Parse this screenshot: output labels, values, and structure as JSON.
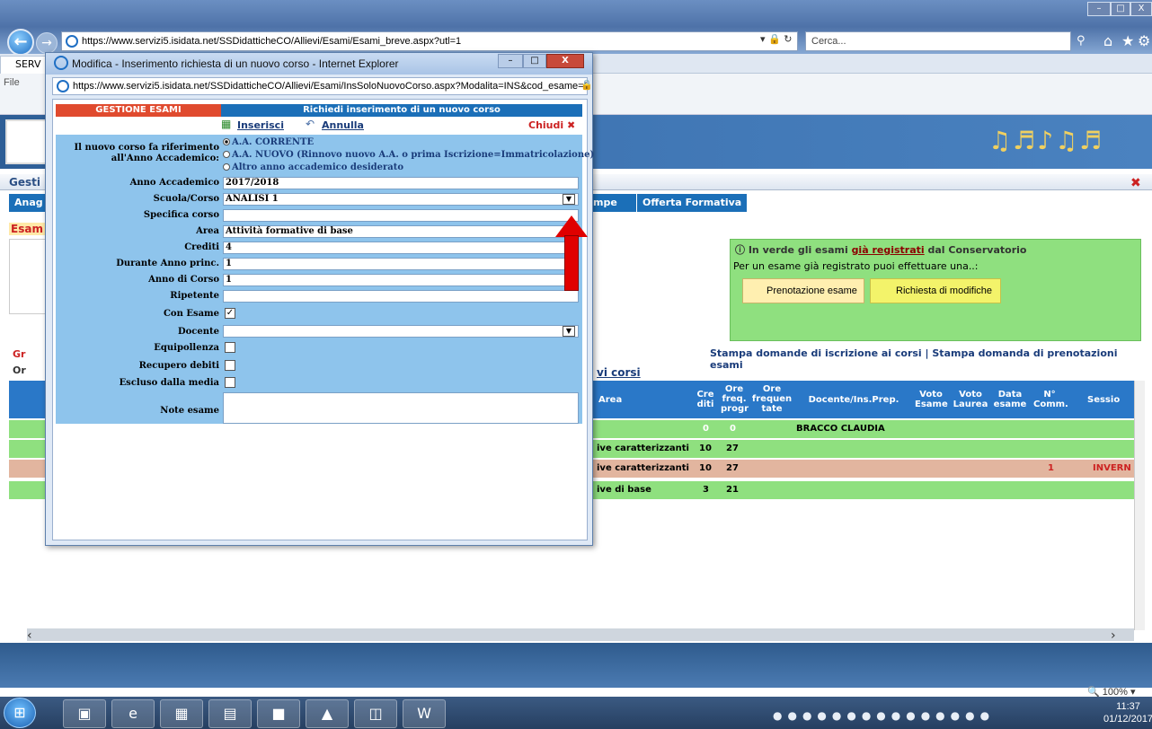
{
  "browser": {
    "url": "https://www.servizi5.isidata.net/SSDidatticheCO/Allievi/Esami/Esami_breve.aspx?utl=1",
    "search_placeholder": "Cerca...",
    "tab_label": "SERV",
    "menu_visible": "File",
    "zoom": "100%"
  },
  "page": {
    "gest_label": "Gesti",
    "nav_anag": "Anag",
    "nav_stampe": "mpe",
    "nav_offerta": "Offerta Formativa",
    "esami_label": "Esam",
    "green_title_pre": "In verde gli esami ",
    "green_title_link": "già registrati",
    "green_title_post": " dal Conservatorio",
    "green_sub": "Per un esame già registrato puoi effettuare una..:",
    "btn_prenotazione": "Prenotazione esame",
    "btn_richiesta": "Richiesta di modifiche",
    "stampa_links": "Stampa domande di iscrizione ai corsi | Stampa domanda di prenotazioni esami",
    "vi_corsi": "vi corsi",
    "gr_label": "Gr",
    "or_label": "Or",
    "table_headers": {
      "area": "Area",
      "crediti": "Cre diti",
      "ore_freq_progr": "Ore freq. progr",
      "ore_frequentate": "Ore frequen tate",
      "docente": "Docente/Ins.Prep.",
      "voto_esame": "Voto Esame",
      "voto_laurea": "Voto Laurea",
      "data_esame": "Data esame",
      "n_comm": "N° Comm.",
      "sessione": "Sessio"
    },
    "rows": [
      {
        "area": "",
        "crediti": "0",
        "ore": "0",
        "docente": "BRACCO CLAUDIA",
        "n_comm": "",
        "sessione": ""
      },
      {
        "area": "ive caratterizzanti",
        "crediti": "10",
        "ore": "27",
        "docente": "",
        "n_comm": "",
        "sessione": ""
      },
      {
        "area": "ive caratterizzanti",
        "crediti": "10",
        "ore": "27",
        "docente": "",
        "n_comm": "1",
        "sessione": "INVERN"
      },
      {
        "area": "ive di base",
        "crediti": "3",
        "ore": "21",
        "docente": "",
        "n_comm": "",
        "sessione": ""
      }
    ]
  },
  "popup": {
    "window_title": "Modifica - Inserimento richiesta di un nuovo corso - Internet Explorer",
    "url": "https://www.servizi5.isidata.net/SSDidatticheCO/Allievi/Esami/InsSoloNuovoCorso.aspx?Modalita=INS&cod_esame=0",
    "section_left": "GESTIONE ESAMI",
    "section_title": "Richiedi inserimento di un nuovo corso",
    "inserisci": "Inserisci",
    "annulla": "Annulla",
    "chiudi": "Chiudi",
    "form": {
      "rif_label": "Il nuovo corso fa riferimento all'Anno Accademico:",
      "radio_1": "A.A. CORRENTE",
      "radio_2": "A.A. NUOVO (Rinnovo nuovo A.A. o prima Iscrizione=Immatricolazione)",
      "radio_3": "Altro anno accademico desiderato",
      "anno_label": "Anno Accademico",
      "anno_value": "2017/2018",
      "scuola_label": "Scuola/Corso",
      "scuola_value": "ANALISI 1",
      "specifica_label": "Specifica corso",
      "specifica_value": "",
      "area_label": "Area",
      "area_value": "Attività formative di base",
      "crediti_label": "Crediti",
      "crediti_value": "4",
      "durante_label": "Durante Anno princ.",
      "durante_value": "1",
      "anno_corso_label": "Anno di Corso",
      "anno_corso_value": "1",
      "ripetente_label": "Ripetente",
      "ripetente_value": "",
      "con_esame_label": "Con Esame",
      "docente_label": "Docente",
      "docente_value": "",
      "equip_label": "Equipollenza",
      "recupero_label": "Recupero debiti",
      "escluso_label": "Escluso dalla media",
      "note_label": "Note esame"
    }
  },
  "taskbar": {
    "time": "11:37",
    "date": "01/12/2017"
  },
  "colors": {
    "form_bg": "#8ec4ec",
    "header_red": "#e04a2e",
    "header_blue": "#1b6fb8",
    "green_panel": "#8fe07f",
    "arrow": "#e00000"
  }
}
